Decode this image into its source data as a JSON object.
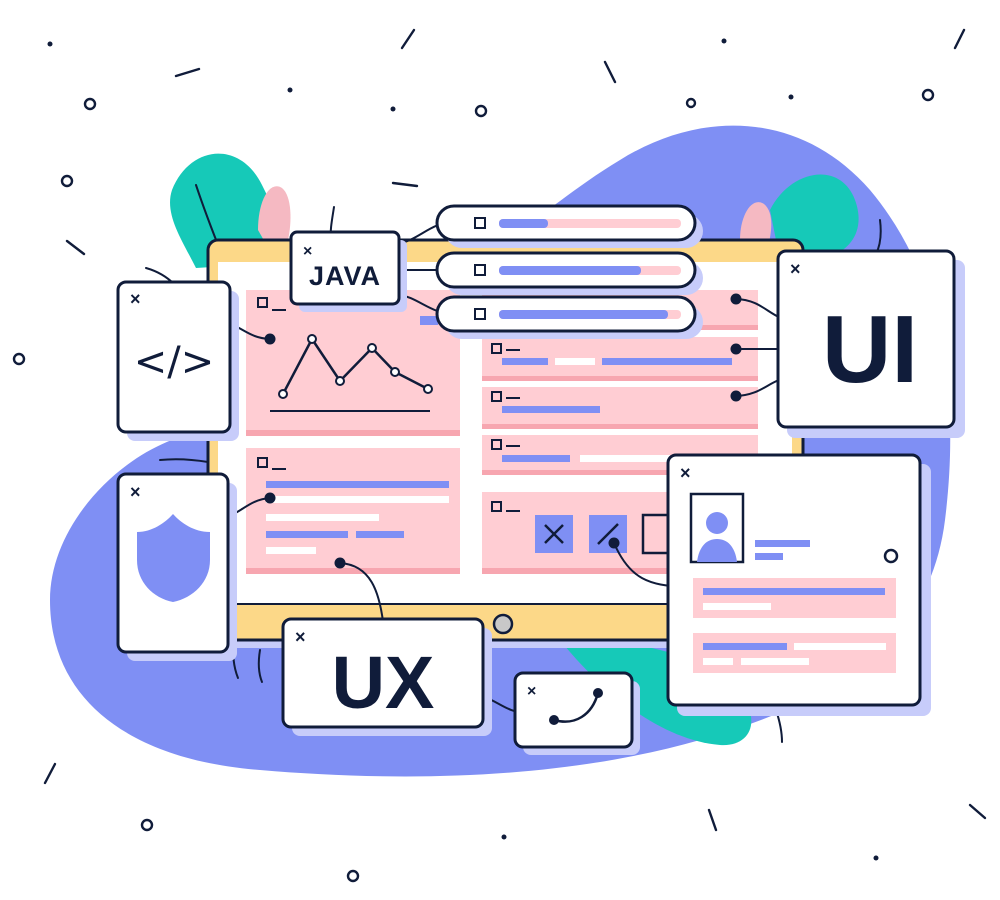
{
  "labels": {
    "java": "JAVA",
    "ui": "UI",
    "ux": "UX",
    "code": "</>",
    "close_mark": "×"
  },
  "colors": {
    "ink": "#101c3a",
    "blob": "#7f8ff4",
    "teal": "#16c9b8",
    "pink_panel": "#ffcdd3",
    "pink_stripe": "#f7a6b0",
    "bar_blue": "#7f8ff4",
    "monitor_frame": "#fcd888",
    "paper": "#ffffff",
    "shadow": "#c7ccfa",
    "drop_pink": "#f5b9c2"
  },
  "icons": [
    "close-icon",
    "code-icon",
    "shield-icon",
    "user-avatar-icon",
    "chart-line-icon",
    "close-square-icon",
    "slash-square-icon",
    "curve-icon",
    "monitor-button-icon"
  ],
  "progress_bars": [
    {
      "fill": 0.27
    },
    {
      "fill": 0.78
    },
    {
      "fill": 0.93
    }
  ]
}
